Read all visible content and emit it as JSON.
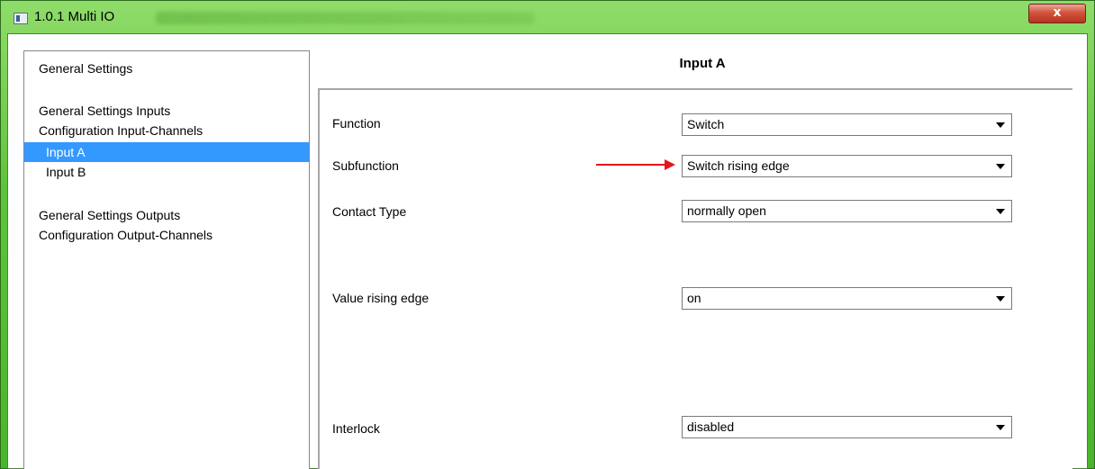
{
  "window": {
    "title": "1.0.1 Multi IO",
    "close_label": "x"
  },
  "tree": {
    "items": [
      {
        "label": "General Settings",
        "level": 0,
        "selected": false
      },
      {
        "label": "General Settings Inputs",
        "level": 0,
        "selected": false
      },
      {
        "label": "Configuration Input-Channels",
        "level": 0,
        "selected": false
      },
      {
        "label": "Input  A",
        "level": 1,
        "selected": true
      },
      {
        "label": "Input  B",
        "level": 1,
        "selected": false
      },
      {
        "label": "General Settings Outputs",
        "level": 0,
        "selected": false
      },
      {
        "label": "Configuration Output-Channels",
        "level": 0,
        "selected": false
      }
    ]
  },
  "panel": {
    "title": "Input  A",
    "params": [
      {
        "label": "Function",
        "value": "Switch"
      },
      {
        "label": "Subfunction",
        "value": "Switch rising edge"
      },
      {
        "label": "Contact Type",
        "value": "normally open"
      },
      {
        "label": "Value rising edge",
        "value": "on"
      },
      {
        "label": "Interlock",
        "value": "disabled"
      }
    ]
  },
  "colors": {
    "selection": "#3399ff",
    "arrow": "#e8141b",
    "frame": "#5fc43a"
  }
}
